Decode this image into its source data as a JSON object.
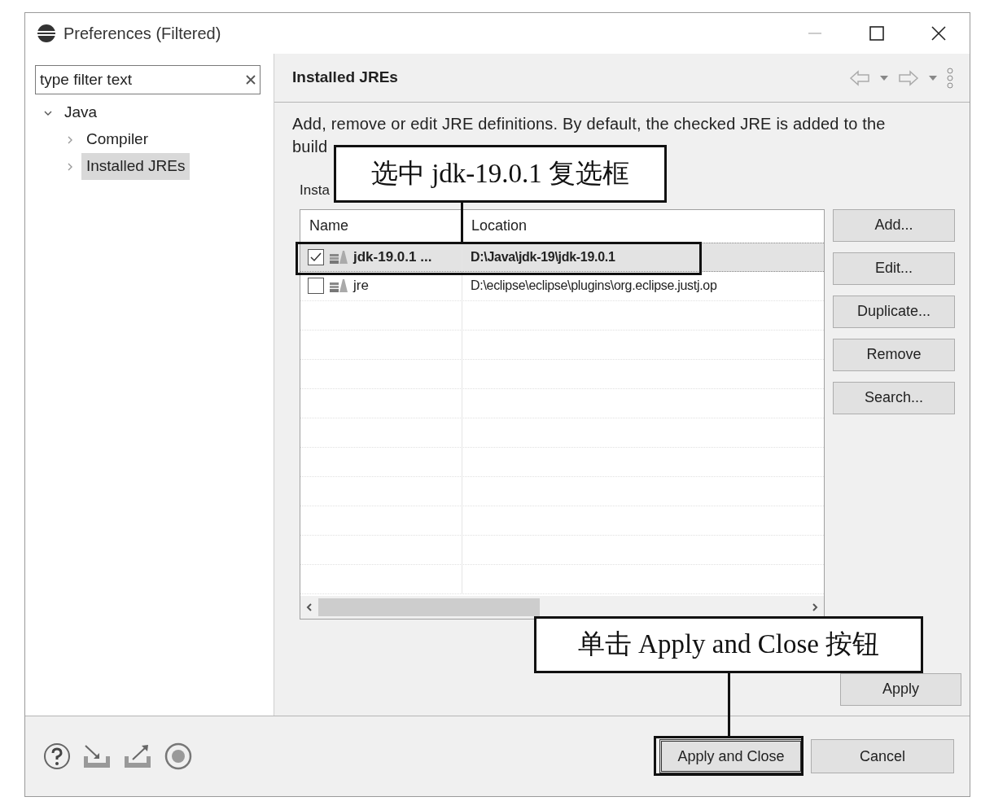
{
  "window": {
    "title": "Preferences (Filtered)"
  },
  "filter": {
    "placeholder": "type filter text"
  },
  "tree": [
    {
      "label": "Java",
      "expanded": true,
      "selected": false,
      "children": [
        {
          "label": "Compiler",
          "expanded": false,
          "selected": false
        },
        {
          "label": "Installed JREs",
          "expanded": false,
          "selected": true
        }
      ]
    }
  ],
  "page": {
    "title": "Installed JREs",
    "description_lines": [
      "Add, remove or edit JRE definitions. By default, the checked JRE is added to the",
      "build"
    ],
    "table_label": "Insta"
  },
  "table": {
    "columns": [
      "Name",
      "Location"
    ],
    "rows": [
      {
        "name": "jdk-19.0.1 ...",
        "location": "D:\\Java\\jdk-19\\jdk-19.0.1",
        "checked": true,
        "selected": true
      },
      {
        "name": "jre",
        "location": "D:\\eclipse\\eclipse\\plugins\\org.eclipse.justj.op",
        "checked": false,
        "selected": false
      }
    ]
  },
  "side_buttons": [
    {
      "label": "Add..."
    },
    {
      "label": "Edit..."
    },
    {
      "label": "Duplicate..."
    },
    {
      "label": "Remove"
    },
    {
      "label": "Search..."
    }
  ],
  "apply": {
    "label": "Apply"
  },
  "footer_buttons": [
    {
      "label": "Apply and Close",
      "default": true
    },
    {
      "label": "Cancel",
      "default": false
    }
  ],
  "annotations": [
    {
      "text": "选中 jdk-19.0.1 复选框"
    },
    {
      "text": "单击 Apply and Close 按钮"
    }
  ]
}
